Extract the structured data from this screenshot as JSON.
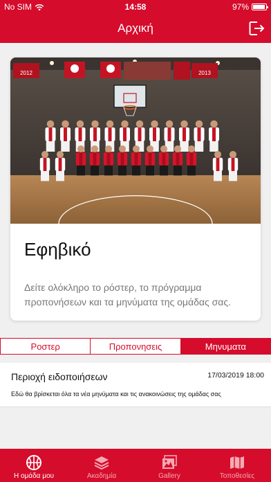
{
  "status_bar": {
    "carrier": "No SIM",
    "time": "14:58",
    "battery_text": "97%",
    "battery_level": 0.97
  },
  "nav": {
    "title": "Αρχική",
    "logout_icon": "logout-icon"
  },
  "card": {
    "title": "Εφηβικό",
    "description": "Δείτε ολόκληρο το ρόστερ, το πρόγραμμα προπονήσεων και τα μηνύματα της ομάδας σας.",
    "banners": [
      "2012",
      "2013"
    ]
  },
  "segments": [
    {
      "label": "Ροστερ",
      "active": false
    },
    {
      "label": "Προπονησεις",
      "active": false
    },
    {
      "label": "Μηνυματα",
      "active": true
    }
  ],
  "message": {
    "title": "Περιοχή ειδοποιήσεων",
    "date": "17/03/2019 18:00",
    "body": "Εδώ θα βρίσκεται όλα τα νέα μηνύματα και τις ανακοινώσεις της ομάδας σας"
  },
  "tabs": [
    {
      "label": "Η ομάδα μου",
      "icon": "basketball-icon",
      "active": true
    },
    {
      "label": "Ακαδημία",
      "icon": "layers-icon",
      "active": false
    },
    {
      "label": "Gallery",
      "icon": "gallery-icon",
      "active": false
    },
    {
      "label": "Τοποθεσίες",
      "icon": "map-icon",
      "active": false
    }
  ],
  "colors": {
    "brand_red": "#d50c2c",
    "white": "#ffffff",
    "text_gray": "#777777"
  }
}
